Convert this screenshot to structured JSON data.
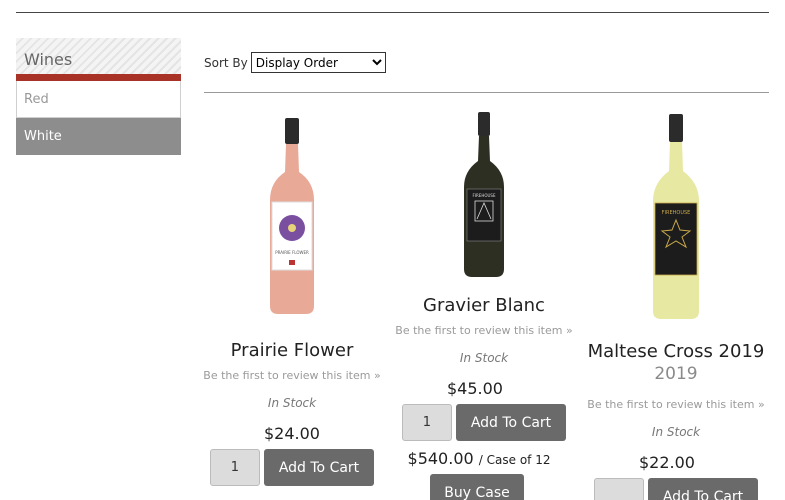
{
  "sidebar": {
    "title": "Wines",
    "items": [
      {
        "label": "Red",
        "active": false
      },
      {
        "label": "White",
        "active": true
      }
    ]
  },
  "sort": {
    "label": "Sort By",
    "selected": "Display Order"
  },
  "products": [
    {
      "name": "Prairie Flower",
      "review": "Be the first to review this item »",
      "stock": "In Stock",
      "price": "$24.00",
      "qty": "1",
      "cart_label": "Add To Cart",
      "label_text": "PRAIRIE FLOWER",
      "colors": {
        "wine": "#e9a997",
        "capsule": "#2b2b2b",
        "label": "#ffffff",
        "flower": "#7b4fa0"
      }
    },
    {
      "name": "Gravier Blanc",
      "review": "Be the first to review this item »",
      "stock": "In Stock",
      "price": "$45.00",
      "qty": "1",
      "cart_label": "Add To Cart",
      "case_price": "$540.00",
      "case_note": "/ Case of 12",
      "case_button": "Buy Case",
      "label_text": "FIREHOUSE",
      "colors": {
        "wine": "#2d2f22",
        "capsule": "#2b2b2b",
        "label": "#1c1c1c"
      }
    },
    {
      "name": "Maltese Cross 2019",
      "vintage": "2019",
      "review": "Be the first to review this item »",
      "stock": "In Stock",
      "price": "$22.00",
      "qty": "",
      "cart_label": "Add To Cart",
      "label_text": "FIREHOUSE",
      "colors": {
        "wine": "#e7e8a2",
        "capsule": "#2b2b2b",
        "label": "#1c1c1c",
        "accent": "#c9a94a"
      }
    }
  ]
}
